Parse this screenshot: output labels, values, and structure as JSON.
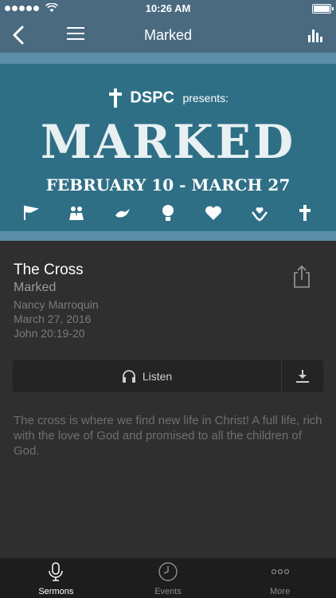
{
  "status_bar": {
    "time": "10:26 AM"
  },
  "navbar": {
    "title": "Marked"
  },
  "banner": {
    "brand": "DSPC",
    "presents": "presents:",
    "headline": "MARKED",
    "dates": "FEBRUARY 10 - MARCH 27",
    "icons": [
      "flag-icon",
      "people-icon",
      "dove-icon",
      "balloon-icon",
      "handshake-heart-icon",
      "hands-heart-icon",
      "cross-icon"
    ]
  },
  "sermon": {
    "title": "The Cross",
    "series": "Marked",
    "speaker": "Nancy Marroquin",
    "date": "March 27, 2016",
    "reference": "John 20:19-20",
    "listen_label": "Listen",
    "description": "The cross is where we find new life in Christ! A full life, rich with the love of God and promised to all the children of God."
  },
  "tabs": [
    {
      "label": "Sermons",
      "icon": "microphone-icon",
      "active": true
    },
    {
      "label": "Events",
      "icon": "clock-icon",
      "active": false
    },
    {
      "label": "More",
      "icon": "ellipsis-icon",
      "active": false
    }
  ],
  "colors": {
    "navbar": "#4a6a80",
    "banner": "#2f6f86",
    "background": "#2f2f2f",
    "tabbar": "#1d1d1d"
  }
}
